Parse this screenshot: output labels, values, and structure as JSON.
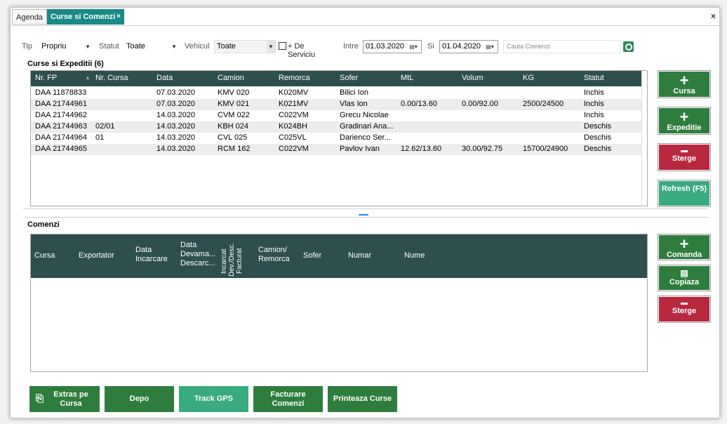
{
  "tabs": [
    {
      "label": "Agenda"
    },
    {
      "label": "Curse si Comenzi",
      "close": "×"
    }
  ],
  "window_close": "×",
  "filters": {
    "tip_label": "Tip",
    "tip_value": "Propriu",
    "statut_label": "Statut",
    "statut_value": "Toate",
    "vehicul_label": "Vehicul",
    "vehicul_value": "Toate",
    "de_serviciu_label": "+ De Serviciu",
    "intre_label": "Intre",
    "date_from": "01.03.2020",
    "si_label": "Si",
    "date_to": "01.04.2020",
    "search_placeholder": "Cauta Comenzi"
  },
  "curse": {
    "title": "Curse si Expeditii (6)",
    "columns": [
      "Nr. FP",
      "Nr. Cursa",
      "Data",
      "Camion",
      "Remorca",
      "Sofer",
      "MtL",
      "Volum",
      "KG",
      "Statut"
    ],
    "rows": [
      [
        "DAA 11878833",
        "",
        "07.03.2020",
        "KMV 020",
        "K020MV",
        "Bilici Ion",
        "",
        "",
        "",
        "Inchis"
      ],
      [
        "DAA 21744961",
        "",
        "07.03.2020",
        "KMV 021",
        "K021MV",
        "Vlas Ion",
        "0.00/13.60",
        "0.00/92.00",
        "2500/24500",
        "Inchis"
      ],
      [
        "DAA 21744962",
        "",
        "14.03.2020",
        "CVM 022",
        "C022VM",
        "Grecu Nicolae",
        "",
        "",
        "",
        "Inchis"
      ],
      [
        "DAA 21744963",
        "02/01",
        "14.03.2020",
        "KBH 024",
        "K024BH",
        "Gradinari Ana...",
        "",
        "",
        "",
        "Deschis"
      ],
      [
        "DAA 21744964",
        "01",
        "14.03.2020",
        "CVL 025",
        "C025VL",
        "Darienco  Ser...",
        "",
        "",
        "",
        "Deschis"
      ],
      [
        "DAA 21744965",
        "",
        "14.03.2020",
        "RCM 162",
        "C022VM",
        "Pavlov Ivan",
        "12.62/13.60",
        "30.00/92.75",
        "15700/24900",
        "Deschis"
      ]
    ],
    "buttons": {
      "cursa": "Cursa",
      "expeditie": "Expeditie",
      "sterge": "Sterge",
      "refresh": "Refresh (F5)"
    }
  },
  "comenzi": {
    "title": "Comenzi",
    "columns": {
      "cursa": "Cursa",
      "exportator": "Exportator",
      "data_incarcare": "Data Incarcare",
      "data_devama": "Data Devama... Descarc...",
      "incarcat": "Incarcat",
      "dev_desc": "Dev./Desc.",
      "facturat": "Facturat",
      "camion_remorca": "Camion/ Remorca",
      "sofer": "Sofer",
      "numar": "Numar",
      "nume": "Nume"
    },
    "buttons": {
      "comanda": "Comanda",
      "copiaza": "Copiaza",
      "sterge": "Sterge"
    }
  },
  "bottom_buttons": {
    "extras": "Extras pe Cursa",
    "depo": "Depo",
    "track_gps": "Track GPS",
    "facturare": "Facturare Comenzi",
    "printeaza": "Printeaza Curse"
  },
  "colors": {
    "header_bg": "#2f4f4f",
    "tab_active": "#1a8a86",
    "button_green": "#2f7d3e",
    "button_red": "#b8283f",
    "button_teal": "#3aaa80"
  }
}
